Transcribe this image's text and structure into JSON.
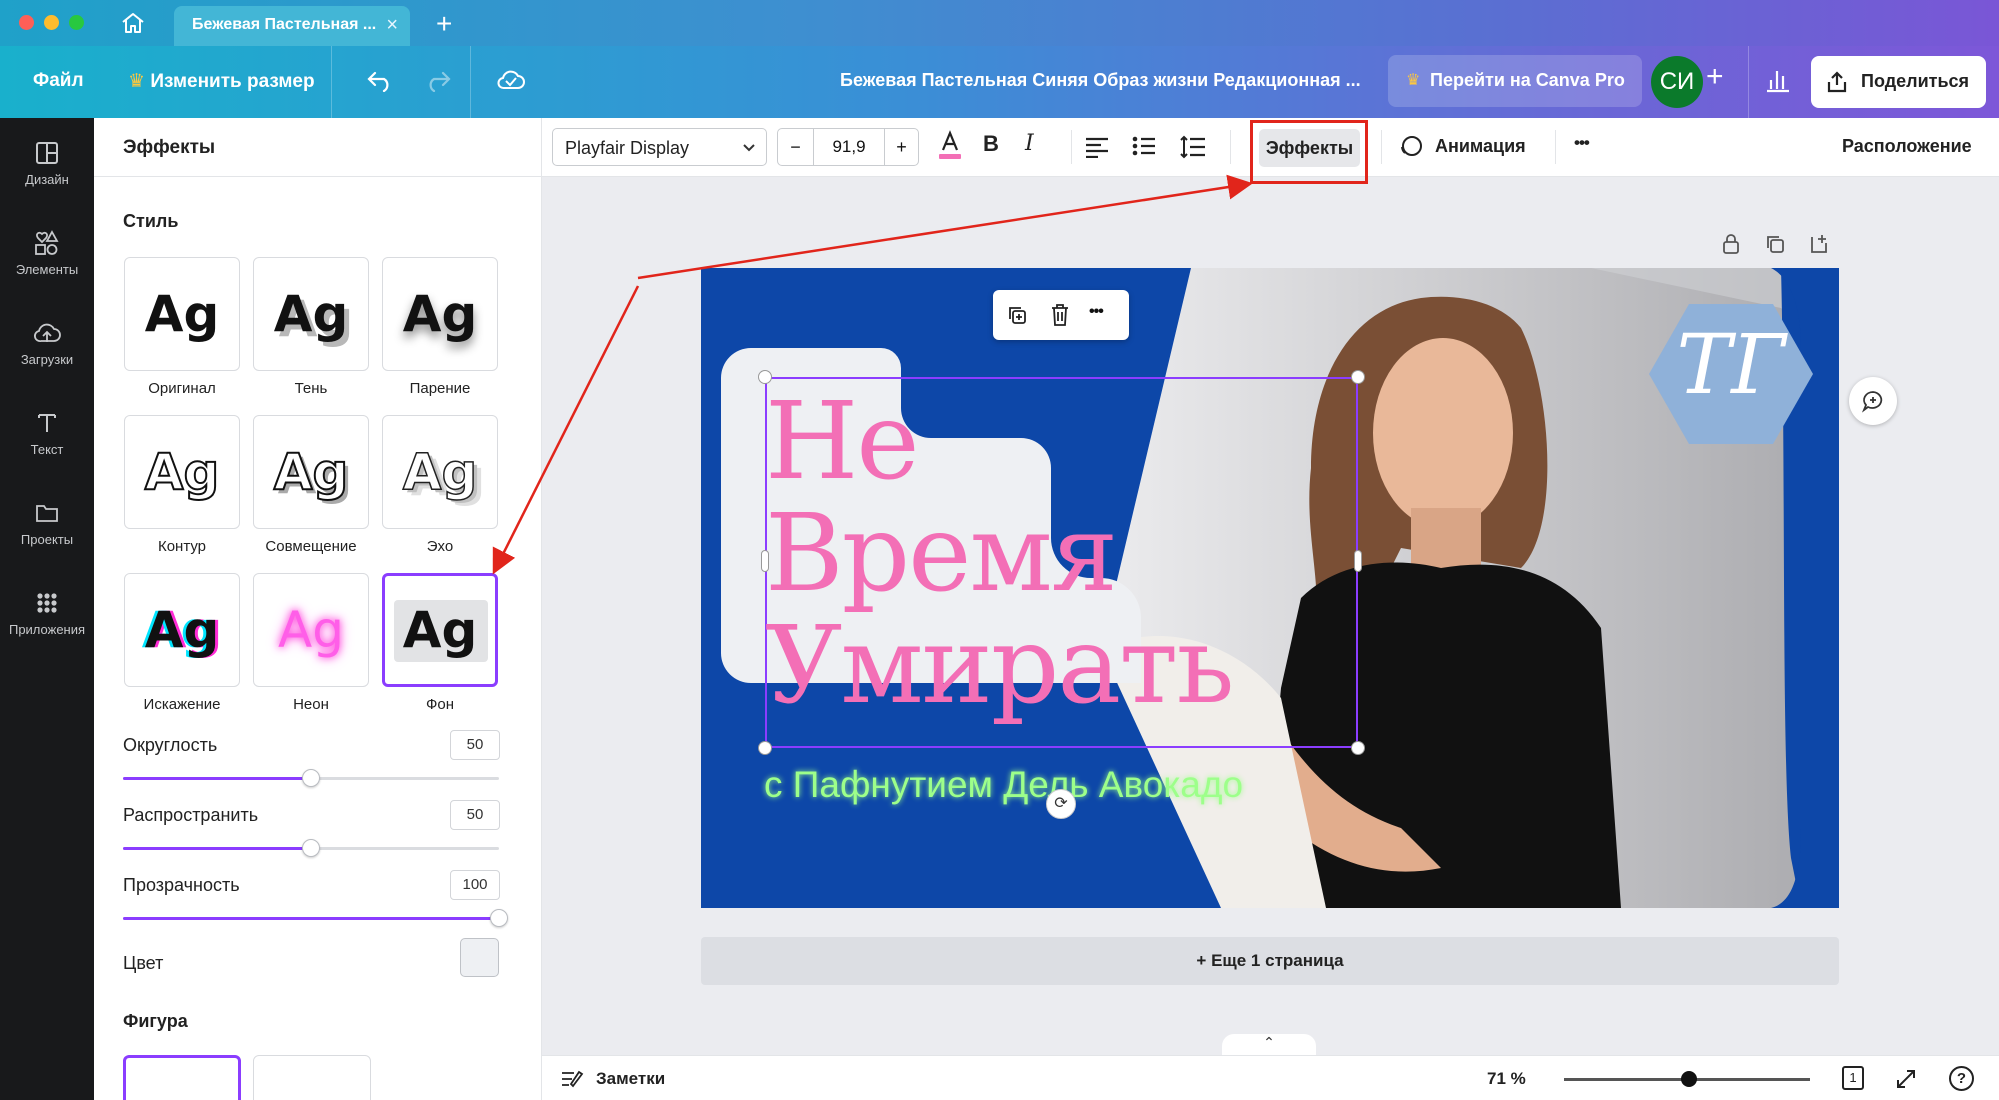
{
  "app": {
    "tab_title": "Бежевая Пастельная ...",
    "doc_title": "Бежевая Пастельная Синяя Образ жизни Редакционная ..."
  },
  "toolbar": {
    "file": "Файл",
    "resize": "Изменить размер",
    "pro": "Перейти на Canva Pro",
    "avatar": "СИ",
    "share": "Поделиться"
  },
  "sidebar": {
    "items": [
      {
        "label": "Дизайн",
        "icon": "layout-icon"
      },
      {
        "label": "Элементы",
        "icon": "shapes-icon"
      },
      {
        "label": "Загрузки",
        "icon": "cloud-upload-icon"
      },
      {
        "label": "Текст",
        "icon": "text-icon"
      },
      {
        "label": "Проекты",
        "icon": "folder-icon"
      },
      {
        "label": "Приложения",
        "icon": "apps-grid-icon"
      }
    ]
  },
  "panel": {
    "title": "Эффекты",
    "style_heading": "Стиль",
    "styles": [
      {
        "label": "Оригинал",
        "sample": "Ag"
      },
      {
        "label": "Тень",
        "sample": "Ag"
      },
      {
        "label": "Парение",
        "sample": "Ag"
      },
      {
        "label": "Контур",
        "sample": "Ag"
      },
      {
        "label": "Совмещение",
        "sample": "Ag"
      },
      {
        "label": "Эхо",
        "sample": "Ag"
      },
      {
        "label": "Искажение",
        "sample": "Ag"
      },
      {
        "label": "Неон",
        "sample": "Ag"
      },
      {
        "label": "Фон",
        "sample": "Ag"
      }
    ],
    "selected_style": "Фон",
    "sliders": [
      {
        "label": "Округлость",
        "value": "50",
        "fraction": 0.5
      },
      {
        "label": "Распространить",
        "value": "50",
        "fraction": 0.5
      },
      {
        "label": "Прозрачность",
        "value": "100",
        "fraction": 1.0
      }
    ],
    "color_label": "Цвет",
    "color_value": "#eef0f3",
    "shape_heading": "Фигура"
  },
  "text_toolbar": {
    "font": "Playfair Display",
    "minus": "−",
    "size": "91,9",
    "plus": "+",
    "bold": "B",
    "italic": "I",
    "effects": "Эффекты",
    "animation": "Анимация",
    "more": "•••",
    "position": "Расположение"
  },
  "design": {
    "headline_lines": [
      "Не",
      "Время",
      "Умирать"
    ],
    "subtitle": "с Пафнутием Дель Авокадо",
    "logo": "ТГ",
    "headline_color": "#f36fb6",
    "subtitle_color": "#9dff8a",
    "background_color": "#0d47a8"
  },
  "canvas": {
    "add_page": "+ Еще 1 страница"
  },
  "bottom": {
    "notes": "Заметки",
    "zoom": "71 %",
    "zoom_fraction": 0.51,
    "page_count": "1",
    "help": "?"
  }
}
